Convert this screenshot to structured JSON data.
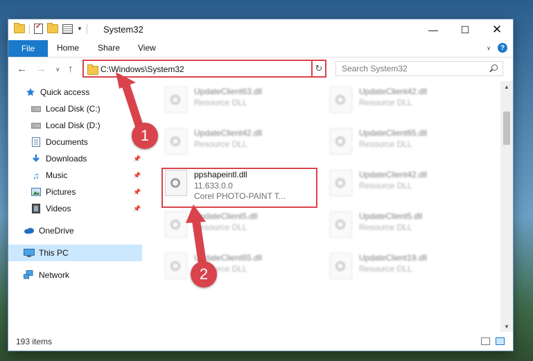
{
  "window": {
    "title": "System32"
  },
  "ribbon": {
    "tabs": [
      "File",
      "Home",
      "Share",
      "View"
    ],
    "help_label": "?"
  },
  "navigation": {
    "address_path": "C:\\Windows\\System32",
    "search_placeholder": "Search System32"
  },
  "sidebar": {
    "items": [
      {
        "label": "Quick access",
        "icon": "star-icon"
      },
      {
        "label": "Local Disk (C:)",
        "icon": "drive-icon"
      },
      {
        "label": "Local Disk (D:)",
        "icon": "drive-icon"
      },
      {
        "label": "Documents",
        "icon": "documents-icon",
        "pinned": true
      },
      {
        "label": "Downloads",
        "icon": "download-icon",
        "pinned": true
      },
      {
        "label": "Music",
        "icon": "music-icon",
        "pinned": true
      },
      {
        "label": "Pictures",
        "icon": "pictures-icon",
        "pinned": true
      },
      {
        "label": "Videos",
        "icon": "videos-icon",
        "pinned": true
      },
      {
        "label": "OneDrive",
        "icon": "cloud-icon"
      },
      {
        "label": "This PC",
        "icon": "computer-icon",
        "selected": true
      },
      {
        "label": "Network",
        "icon": "network-icon"
      }
    ]
  },
  "files": {
    "highlighted": {
      "name": "ppshapeintl.dll",
      "version": "11.633.0.0",
      "description": "Corel PHOTO-PAINT T..."
    },
    "tiles": [
      {
        "name": "UpdateClient63.dll",
        "desc": "Resource DLL"
      },
      {
        "name": "UpdateClient42.dll",
        "desc": "Resource DLL"
      },
      {
        "name": "UpdateClient42.dll",
        "desc": "Resource DLL"
      },
      {
        "name": "UpdateClient65.dll",
        "desc": "Resource DLL"
      },
      {
        "name": "UpdateClient42.dll",
        "desc": "Resource DLL"
      },
      {
        "name": "UpdateClient5.dll",
        "desc": "Resource DLL"
      },
      {
        "name": "UpdateClient5.dll",
        "desc": "Resource DLL"
      },
      {
        "name": "UpdateClient65.dll",
        "desc": "Resource DLL"
      },
      {
        "name": "UpdateClient19.dll",
        "desc": "Resource DLL"
      }
    ]
  },
  "status": {
    "item_count": "193 items"
  },
  "annotations": {
    "step1": "1",
    "step2": "2",
    "color": "#d9434b"
  }
}
